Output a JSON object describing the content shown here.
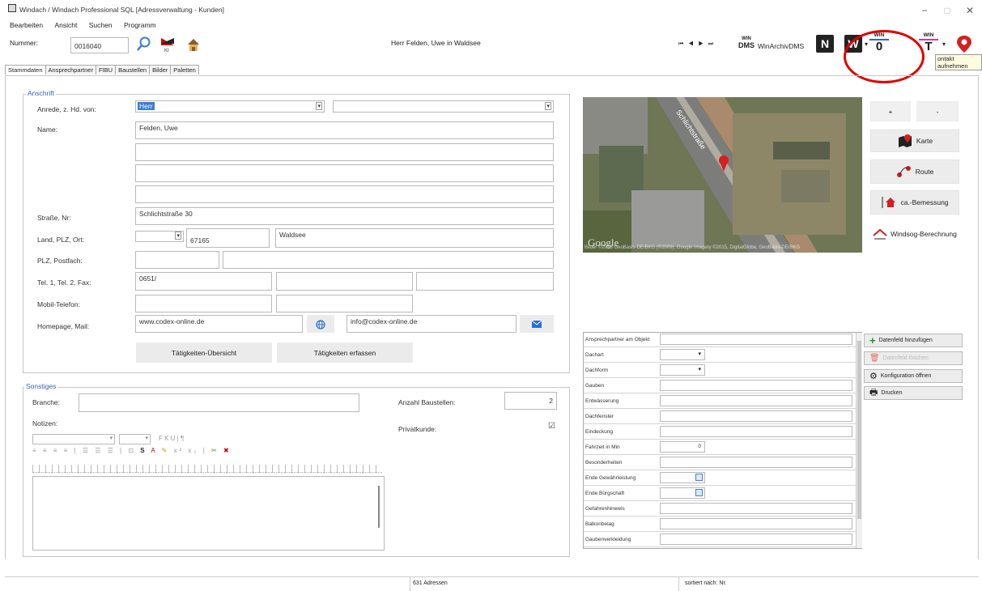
{
  "window": {
    "title": "Windach / Windach Professional SQL [Adressverwaltung - Kunden]",
    "min": "−",
    "max": "□",
    "close": "✕"
  },
  "menu": [
    "Bearbeiten",
    "Ansicht",
    "Suchen",
    "Programm"
  ],
  "toolbar": {
    "nummer_label": "Nummer:",
    "nummer_value": "0016040",
    "header_name": "Herr Felden, Uwe in Waldsee",
    "archiv_label": "WinArchivDMS",
    "dms_icon_top": "WIN",
    "dms_icon_text": "DMS",
    "win_top": "WIN",
    "win_digit": "0",
    "win_t": "T",
    "kontakt_label": "ontakt aufnehmen",
    "nav": [
      "⏮",
      "◀",
      "▶",
      "⏭"
    ]
  },
  "tabs": [
    "Stammdaten",
    "Ansprechpartner",
    "FIBU",
    "Baustellen",
    "Bilder",
    "Paletten"
  ],
  "anschrift": {
    "title": "Anschrift",
    "anrede_label": "Anrede, z. Hd. von:",
    "anrede_value": "Herr",
    "name_label": "Name:",
    "name_value": "Felden, Uwe",
    "strasse_label": "Straße, Nr:",
    "strasse_value": "Schlichtstraße 30",
    "land_label": "Land, PLZ, Ort:",
    "plz_value": "67165",
    "ort_value": "Waldsee",
    "postfach_label": "PLZ, Postfach:",
    "tel_label": "Tel. 1, Tel. 2, Fax:",
    "tel1_value": "0651/",
    "mobil_label": "Mobil-Telefon:",
    "homepage_label": "Homepage, Mail:",
    "homepage_value": "www.codex-online.de",
    "mail_value": "info@codex-online.de",
    "btn_uebersicht": "Tätigkeiten-Übersicht",
    "btn_erfassen": "Tätigkeiten erfassen"
  },
  "sonstiges": {
    "title": "Sonstiges",
    "branche_label": "Branche:",
    "notizen_label": "Notizen:",
    "baustellen_label": "Anzahl Baustellen:",
    "baustellen_value": "2",
    "privat_label": "Privatkunde:",
    "privat_check": "☑",
    "fmt": "F   K   U  |  ¶"
  },
  "map": {
    "zoom_in": "+",
    "zoom_out": "-",
    "street": "Schlichtstraße",
    "google": "Google",
    "credits": "Bilder ©2015 GeoBasis-DE/BKG (©2009), Google Imagery ©2015, DigitalGlobe, GeoBasis-DE/BKG",
    "buttons": [
      "Karte",
      "Route",
      "ca.-Bemessung",
      "Windsog-Berechnung"
    ]
  },
  "grid": {
    "rows": [
      {
        "label": "Ansprechpartner am Objekt",
        "value": ""
      },
      {
        "label": "Dachart",
        "value": ""
      },
      {
        "label": "Dachform",
        "value": ""
      },
      {
        "label": "Gauben",
        "value": ""
      },
      {
        "label": "Entwässerung",
        "value": ""
      },
      {
        "label": "Dachfenster",
        "value": ""
      },
      {
        "label": "Eindeckung",
        "value": ""
      },
      {
        "label": "Fahrzeit in Min",
        "value": "0"
      },
      {
        "label": "Besonderheiten",
        "value": ""
      },
      {
        "label": "Ende Gewährleistung",
        "value": ""
      },
      {
        "label": "Ende Bürgschaft",
        "value": ""
      },
      {
        "label": "Gefahrenhinweis",
        "value": ""
      },
      {
        "label": "Balkonbelag",
        "value": ""
      },
      {
        "label": "Gaubenverkleidung",
        "value": ""
      }
    ]
  },
  "side_buttons": [
    "Datenfeld hinzufügen",
    "Datenfeld löschen",
    "Konfiguration öffnen",
    "Drucken"
  ],
  "status": {
    "count": "631 Adressen",
    "sort": "sortiert nach: Nr."
  },
  "colors": {
    "accent": "#3a64b4",
    "annotation": "#e00000"
  }
}
